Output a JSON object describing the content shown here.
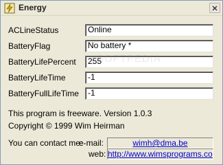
{
  "window": {
    "title": "Energy"
  },
  "fields": [
    {
      "label": "ACLineStatus",
      "value": "Online"
    },
    {
      "label": "BatteryFlag",
      "value": "No battery  *"
    },
    {
      "label": "BatteryLifePercent",
      "value": "255"
    },
    {
      "label": "BatteryLifeTime",
      "value": "-1"
    },
    {
      "label": "BatteryFullLifeTime",
      "value": "-1"
    }
  ],
  "info": {
    "freeware": "This program is freeware. Version 1.0.3",
    "copyright": "Copyright © 1999  Wim Heirman"
  },
  "contact": {
    "intro": "You can contact me:",
    "email_label": "e-mail:",
    "email": "wimh@dma.be",
    "web_label": "web:",
    "web": "http://www.wimsprograms.com/"
  },
  "watermark": "SOFTPEDIA",
  "icons": {
    "app": "energy-app-icon",
    "close": "close-icon"
  }
}
